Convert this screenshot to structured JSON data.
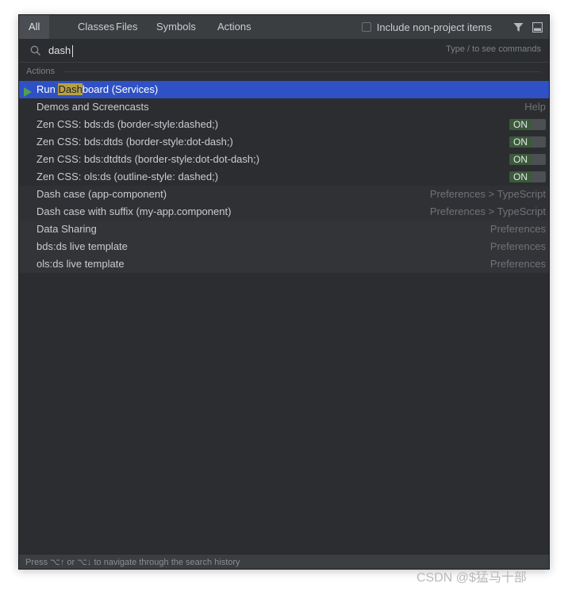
{
  "tabs": [
    {
      "label": "All",
      "active": true
    },
    {
      "label": "Classes",
      "active": false
    },
    {
      "label": "Files",
      "active": false
    },
    {
      "label": "Symbols",
      "active": false
    },
    {
      "label": "Actions",
      "active": false
    }
  ],
  "options": {
    "include_label": "Include non-project items",
    "filter_icon": "filter-icon",
    "preview_icon": "preview-panel-icon"
  },
  "search": {
    "value": "dash",
    "hint": "Type / to see commands"
  },
  "section": {
    "label": "Actions"
  },
  "results": [
    {
      "prefix": "Run ",
      "match": "Dash",
      "suffix": "board (Services)",
      "right": "",
      "toggle": "",
      "selected": true
    },
    {
      "text": "Demos and Screencasts",
      "right": "Help",
      "toggle": ""
    },
    {
      "text": "Zen CSS: bds:ds (border-style:dashed;)",
      "right": "",
      "toggle": "ON"
    },
    {
      "text": "Zen CSS: bds:dtds (border-style:dot-dash;)",
      "right": "",
      "toggle": "ON"
    },
    {
      "text": "Zen CSS: bds:dtdtds (border-style:dot-dot-dash;)",
      "right": "",
      "toggle": "ON"
    },
    {
      "text": "Zen CSS: ols:ds (outline-style: dashed;)",
      "right": "",
      "toggle": "ON"
    },
    {
      "text": "Dash case (app-component)",
      "right": "Preferences > TypeScript",
      "toggle": ""
    },
    {
      "text": "Dash case with suffix (my-app.component)",
      "right": "Preferences > TypeScript",
      "toggle": ""
    },
    {
      "text": "Data Sharing",
      "right": "Preferences",
      "toggle": ""
    },
    {
      "text": "bds:ds live template",
      "right": "Preferences",
      "toggle": ""
    },
    {
      "text": "ols:ds live template",
      "right": "Preferences",
      "toggle": ""
    }
  ],
  "footer": {
    "text": "Press ⌥↑ or ⌥↓ to navigate through the search history"
  },
  "watermark": "CSDN @$猛马十部",
  "colors": {
    "selected": "#2f51c5",
    "highlight": "#b6a246",
    "toggle_on": "#3a5a3a",
    "run_icon": "#4fa24f"
  }
}
